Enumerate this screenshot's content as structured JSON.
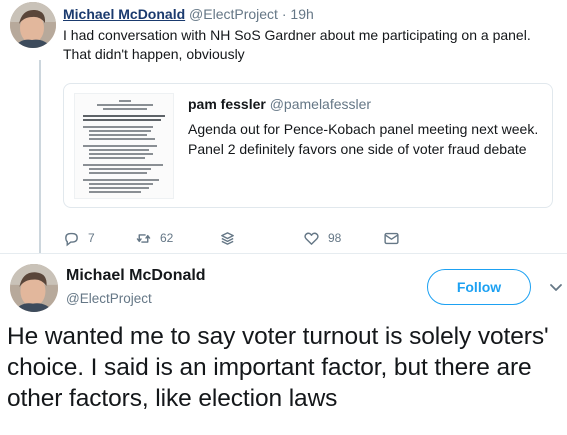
{
  "parent_tweet": {
    "author_name": "Michael McDonald",
    "author_handle": "@ElectProject",
    "separator": "·",
    "timestamp": "19h",
    "text": "I had conversation with NH SoS Gardner about me participating on a panel. That didn't happen, obviously",
    "quoted_tweet": {
      "author_name": "pam fessler",
      "author_handle": "@pamelafessler",
      "text": "Agenda out for Pence-Kobach panel meeting next week. Panel 2 definitely favors one side of voter fraud debate"
    },
    "actions": {
      "reply_count": "7",
      "retweet_count": "62",
      "like_count": "98"
    }
  },
  "main_tweet": {
    "author_name": "Michael McDonald",
    "author_handle": "@ElectProject",
    "follow_label": "Follow",
    "text": "He wanted me to say voter turnout is solely voters' choice. I said is an important factor, but there are other factors, like election laws"
  },
  "colors": {
    "accent": "#1da1f2",
    "link_name": "#1a3a6e",
    "secondary_text": "#657786",
    "border": "#e1e8ed"
  },
  "icons": [
    "reply-icon",
    "retweet-icon",
    "stack-icon",
    "like-icon",
    "message-icon",
    "chevron-down-icon"
  ]
}
